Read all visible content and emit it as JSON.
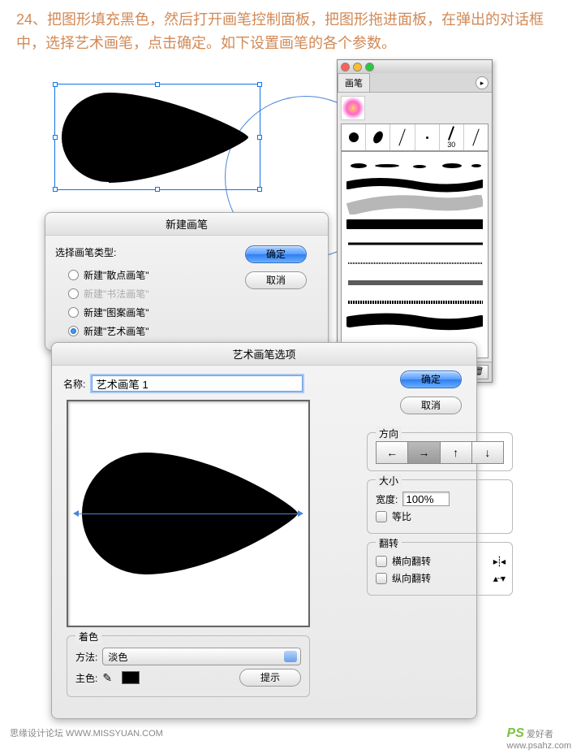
{
  "step": {
    "num": "24、",
    "text": "把图形填充黑色，然后打开画笔控制面板，把图形拖进面板，在弹出的对话框中，选择艺术画笔，点击确定。如下设置画笔的各个参数。"
  },
  "dialog1": {
    "title": "新建画笔",
    "label": "选择画笔类型:",
    "opts": [
      "新建\"散点画笔\"",
      "新建\"书法画笔\"",
      "新建\"图案画笔\"",
      "新建\"艺术画笔\""
    ],
    "ok": "确定",
    "cancel": "取消"
  },
  "panel": {
    "tab": "画笔",
    "menu": "▸",
    "cell30": "30"
  },
  "dialog2": {
    "title": "艺术画笔选项",
    "name_label": "名称:",
    "name_value": "艺术画笔 1",
    "ok": "确定",
    "cancel": "取消",
    "dir": "方向",
    "size": "大小",
    "width_label": "宽度:",
    "width_value": "100%",
    "ratio": "等比",
    "flip": "翻转",
    "flip_h": "横向翻转",
    "flip_v": "纵向翻转",
    "color": "着色",
    "method": "方法:",
    "method_value": "淡色",
    "main": "主色:",
    "hint": "提示"
  },
  "footer": {
    "left": "思缘设计论坛  WWW.MISSYUAN.COM",
    "brand": "PS",
    "brand_txt": "爱好者",
    "url": "www.psahz.com"
  }
}
